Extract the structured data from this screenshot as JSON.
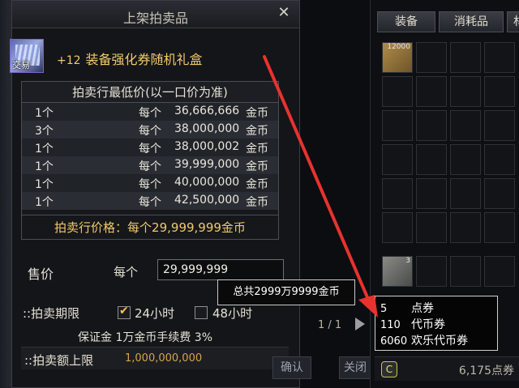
{
  "dialog": {
    "title": "上架拍卖品",
    "close_glyph": "✕"
  },
  "item": {
    "icon_tag": "交易",
    "enhance": "+12",
    "name": "装备强化券随机礼盒"
  },
  "lowest": {
    "header": "拍卖行最低价(以一口价为准)",
    "rows": [
      {
        "qty": "1个",
        "each": "每个",
        "price": "36,666,666",
        "cur": "金币"
      },
      {
        "qty": "3个",
        "each": "每个",
        "price": "38,000,000",
        "cur": "金币"
      },
      {
        "qty": "1个",
        "each": "每个",
        "price": "38,000,002",
        "cur": "金币"
      },
      {
        "qty": "1个",
        "each": "每个",
        "price": "39,999,000",
        "cur": "金币"
      },
      {
        "qty": "1个",
        "each": "每个",
        "price": "40,000,000",
        "cur": "金币"
      },
      {
        "qty": "1个",
        "each": "每个",
        "price": "42,500,000",
        "cur": "金币"
      }
    ],
    "footer": "拍卖行价格：每个29,999,999金币"
  },
  "sale": {
    "label": "售价",
    "each": "每个",
    "value": "29,999,999",
    "tooltip": "总共2999万9999金币"
  },
  "period": {
    "label": "::拍卖期限",
    "opt24": "24小时",
    "opt48": "48小时"
  },
  "deposit": "保证金 1万金币手续费 3%",
  "limit": {
    "label": "::拍卖额上限",
    "value": "1,000,000,000"
  },
  "buttons": {
    "left": "确认",
    "right": "关闭"
  },
  "inventory": {
    "tabs": [
      "装备",
      "消耗品",
      "材"
    ],
    "slot1_num": "12000",
    "slot2_num": "3",
    "pager": "1 / 1",
    "balance": "6,175点券"
  },
  "currency_popup": [
    {
      "count": "5",
      "name": "点券"
    },
    {
      "count": "110",
      "name": "代币券"
    },
    {
      "count": "6060",
      "name": "欢乐代币券"
    }
  ],
  "colors": {
    "gold": "#f2c96a",
    "arrow": "#e8322e"
  }
}
